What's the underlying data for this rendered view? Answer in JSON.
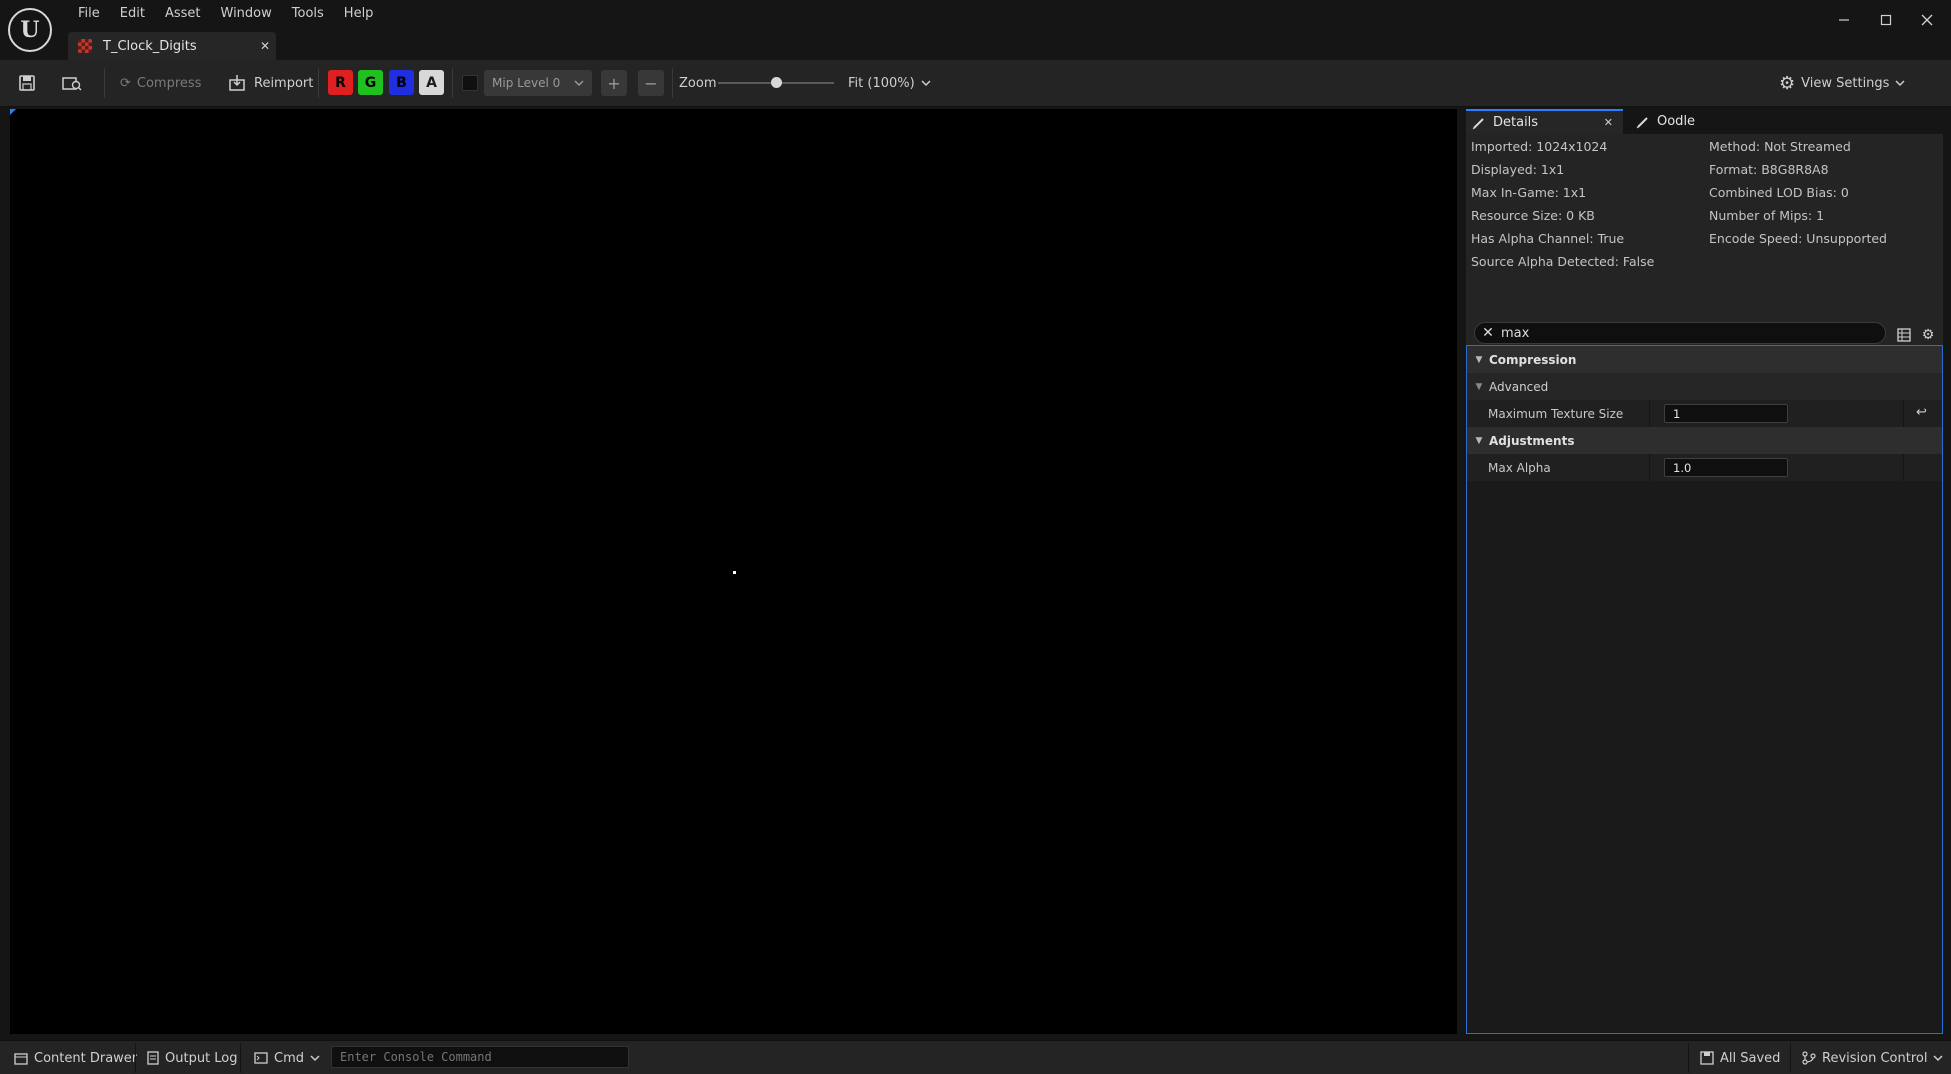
{
  "app": {
    "menus": [
      "File",
      "Edit",
      "Asset",
      "Window",
      "Tools",
      "Help"
    ],
    "tab_title": "T_Clock_Digits",
    "logo_text": "U"
  },
  "toolbar": {
    "compress_label": "Compress",
    "reimport_label": "Reimport",
    "channels": [
      {
        "label": "R",
        "color": "#e02020"
      },
      {
        "label": "G",
        "color": "#1fc01f"
      },
      {
        "label": "B",
        "color": "#1f2fe0"
      },
      {
        "label": "A",
        "color": "#d8d8d8"
      }
    ],
    "mip_level": "Mip Level 0",
    "zoom_label": "Zoom",
    "zoom_level": 0.5,
    "fit_label": "Fit (100%)",
    "view_settings_label": "View Settings"
  },
  "details": {
    "tabs": [
      {
        "label": "Details"
      },
      {
        "label": "Oodle"
      }
    ],
    "info_left": [
      "Imported: 1024x1024",
      "Displayed: 1x1",
      "Max In-Game: 1x1",
      "Resource Size: 0 KB",
      "Has Alpha Channel: True",
      "Source Alpha Detected: False"
    ],
    "info_right": [
      "Method: Not Streamed",
      "Format: B8G8R8A8",
      "Combined LOD Bias: 0",
      "Number of Mips: 1",
      "Encode Speed: Unsupported"
    ],
    "search_value": "max",
    "properties": {
      "compression_label": "Compression",
      "advanced_label": "Advanced",
      "max_texture_size_label": "Maximum Texture Size",
      "max_texture_size_value": "1",
      "adjustments_label": "Adjustments",
      "max_alpha_label": "Max Alpha",
      "max_alpha_value": "1.0"
    }
  },
  "statusbar": {
    "content_drawer": "Content Drawer",
    "output_log": "Output Log",
    "cmd": "Cmd",
    "console_placeholder": "Enter Console Command",
    "all_saved": "All Saved",
    "revision_control": "Revision Control"
  },
  "colors": {
    "accent": "#2a7fff",
    "viewport_bg": "#000000"
  }
}
